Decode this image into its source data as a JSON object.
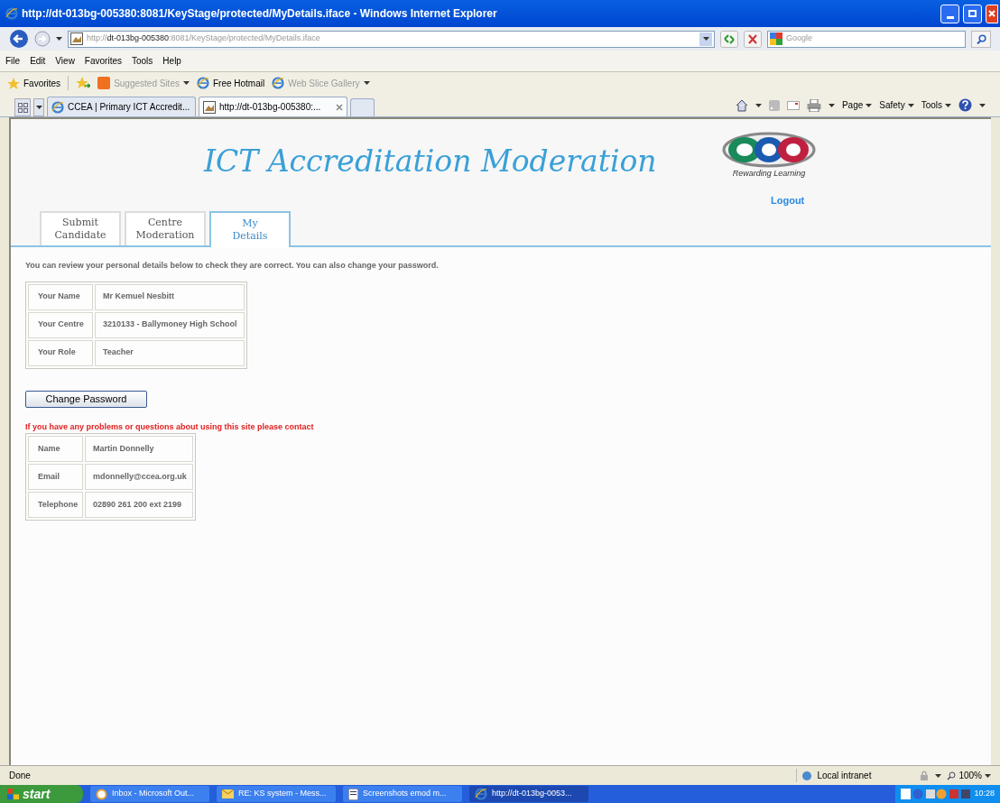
{
  "window": {
    "title": "http://dt-013bg-005380:8081/KeyStage/protected/MyDetails.iface - Windows Internet Explorer"
  },
  "address_bar": {
    "url_scheme": "http://",
    "url_host": "dt-013bg-005380",
    "url_path": ":8081/KeyStage/protected/MyDetails.iface",
    "search_placeholder": "Google"
  },
  "menu": [
    "File",
    "Edit",
    "View",
    "Favorites",
    "Tools",
    "Help"
  ],
  "favorites_bar": {
    "favorites": "Favorites",
    "links": [
      {
        "label": "Suggested Sites",
        "kind": "suggested",
        "dropdown": true,
        "dimmed": true
      },
      {
        "label": "Free Hotmail",
        "kind": "ie",
        "dropdown": false,
        "dimmed": false
      },
      {
        "label": "Web Slice Gallery",
        "kind": "ie",
        "dropdown": true,
        "dimmed": true
      }
    ]
  },
  "browser_tabs": [
    {
      "label": "CCEA | Primary ICT Accredit...",
      "selected": false,
      "closable": false
    },
    {
      "label": "http://dt-013bg-005380:...",
      "selected": true,
      "closable": true
    }
  ],
  "command_bar": [
    "Page",
    "Safety",
    "Tools"
  ],
  "page": {
    "title": "ICT Accreditation Moderation",
    "logo_tagline": "Rewarding Learning",
    "logout": "Logout",
    "tabs": [
      {
        "label": "Submit\nCandidate",
        "selected": false
      },
      {
        "label": "Centre\nModeration",
        "selected": false
      },
      {
        "label": "My\nDetails",
        "selected": true
      }
    ],
    "intro": "You can review your personal details below to check they are correct. You can also change your password.",
    "details": [
      {
        "label": "Your Name",
        "value": "Mr Kemuel Nesbitt"
      },
      {
        "label": "Your Centre",
        "value": "3210133 - Ballymoney High School"
      },
      {
        "label": "Your Role",
        "value": "Teacher"
      }
    ],
    "change_password": "Change Password",
    "contact_note": "If you have any problems or questions about using this site please contact",
    "contact": [
      {
        "label": "Name",
        "value": "Martin Donnelly"
      },
      {
        "label": "Email",
        "value": "mdonnelly@ccea.org.uk"
      },
      {
        "label": "Telephone",
        "value": "02890 261 200 ext 2199"
      }
    ]
  },
  "status_bar": {
    "status": "Done",
    "zone": "Local intranet",
    "zoom": "100%"
  },
  "taskbar": {
    "start": "start",
    "tasks": [
      {
        "label": "Inbox - Microsoft Out...",
        "kind": "outlook",
        "selected": false
      },
      {
        "label": "RE: KS system - Mess...",
        "kind": "mail",
        "selected": false
      },
      {
        "label": "Screenshots emod m...",
        "kind": "doc",
        "selected": false
      },
      {
        "label": "http://dt-013bg-0053...",
        "kind": "ie",
        "selected": true
      }
    ],
    "clock": "10:28"
  }
}
